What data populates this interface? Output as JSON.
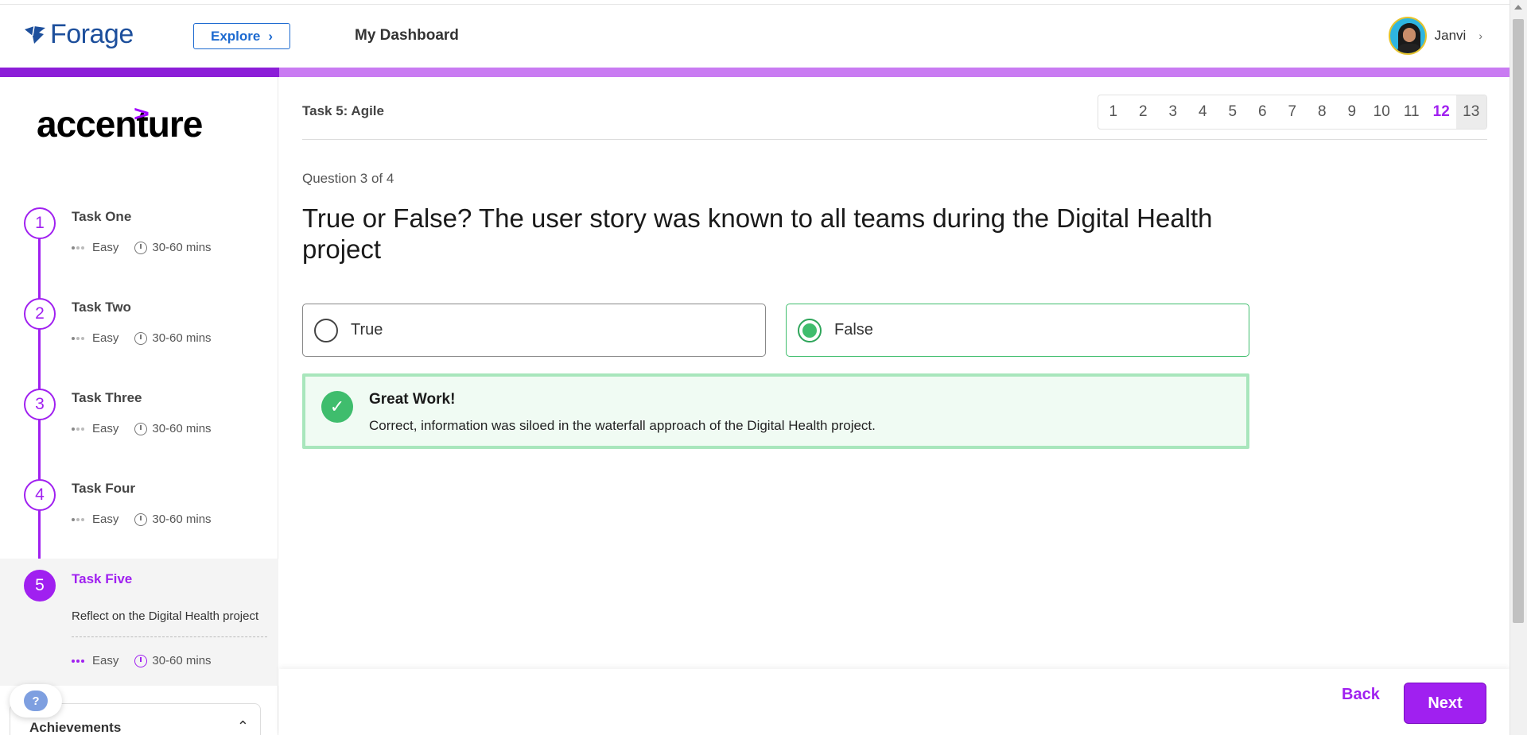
{
  "header": {
    "logo_text": "Forage",
    "explore_label": "Explore",
    "dashboard_label": "My Dashboard",
    "user_name": "Janvi"
  },
  "progress": {
    "value": 0.185
  },
  "sidebar": {
    "company_logo_text": "accenture",
    "tasks": [
      {
        "number": "1",
        "title": "Task One",
        "difficulty": "Easy",
        "duration": "30-60 mins"
      },
      {
        "number": "2",
        "title": "Task Two",
        "difficulty": "Easy",
        "duration": "30-60 mins"
      },
      {
        "number": "3",
        "title": "Task Three",
        "difficulty": "Easy",
        "duration": "30-60 mins"
      },
      {
        "number": "4",
        "title": "Task Four",
        "difficulty": "Easy",
        "duration": "30-60 mins"
      },
      {
        "number": "5",
        "title": "Task Five",
        "description": "Reflect on the Digital Health project",
        "difficulty": "Easy",
        "duration": "30-60 mins",
        "active": true
      }
    ],
    "achievements_label": "Achievements",
    "help_label": "?"
  },
  "main": {
    "task_label": "Task 5: Agile",
    "pages": [
      "1",
      "2",
      "3",
      "4",
      "5",
      "6",
      "7",
      "8",
      "9",
      "10",
      "11",
      "12",
      "13"
    ],
    "current_page": "12",
    "question_count": "Question 3 of 4",
    "question": "True or False? The user story was known to all teams during the Digital Health project",
    "options": [
      {
        "label": "True",
        "selected": false
      },
      {
        "label": "False",
        "selected": true
      }
    ],
    "feedback": {
      "title": "Great Work!",
      "text": "Correct, information was siloed in the waterfall approach of the Digital Health project."
    }
  },
  "footer": {
    "back_label": "Back",
    "next_label": "Next"
  },
  "colors": {
    "brand_purple": "#a020f0",
    "success_green": "#3fbd6d",
    "forage_blue": "#1d4f9c"
  }
}
